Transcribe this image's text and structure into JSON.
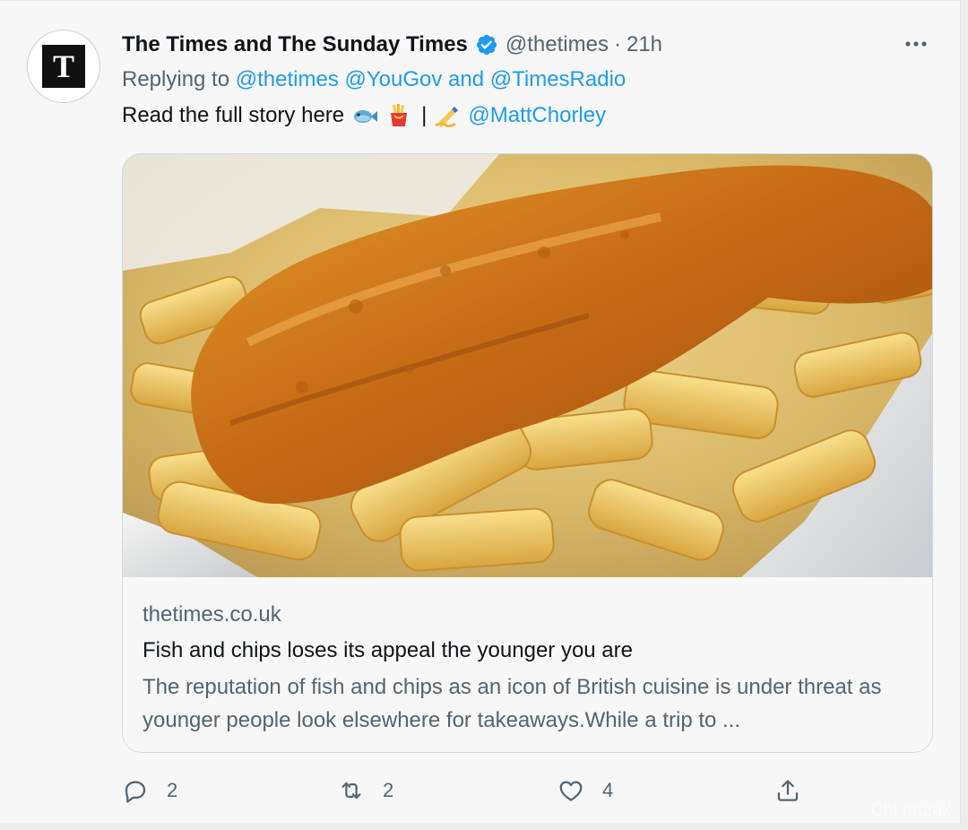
{
  "tweet": {
    "author": {
      "display_name": "The Times and The Sunday Times",
      "handle": "@thetimes",
      "avatar_letter": "T",
      "verified": true
    },
    "separator": "·",
    "time": "21h",
    "replying": {
      "prefix": "Replying to",
      "mentions": "@thetimes @YouGov and @TimesRadio"
    },
    "text": {
      "lead": "Read the full story here",
      "separator": "|",
      "mention": "@MattChorley"
    },
    "emojis": [
      "fish-emoji",
      "fries-emoji",
      "writing-hand-emoji"
    ],
    "card": {
      "image": "fish-and-chips-photo",
      "domain": "thetimes.co.uk",
      "title": "Fish and chips loses its appeal the younger you are",
      "description": "The reputation of fish and chips as an icon of British cuisine is under threat as younger people look elsewhere for takeaways.While a trip to ..."
    },
    "actions": {
      "reply_count": "2",
      "retweet_count": "2",
      "like_count": "4"
    },
    "watermark": "Chi na2uk"
  },
  "colors": {
    "background": "#f7f7f7",
    "text": "#0f1419",
    "muted": "#536471",
    "link": "#1d9bf0",
    "verified": "#1d9bf0",
    "border": "#cfd9de"
  }
}
